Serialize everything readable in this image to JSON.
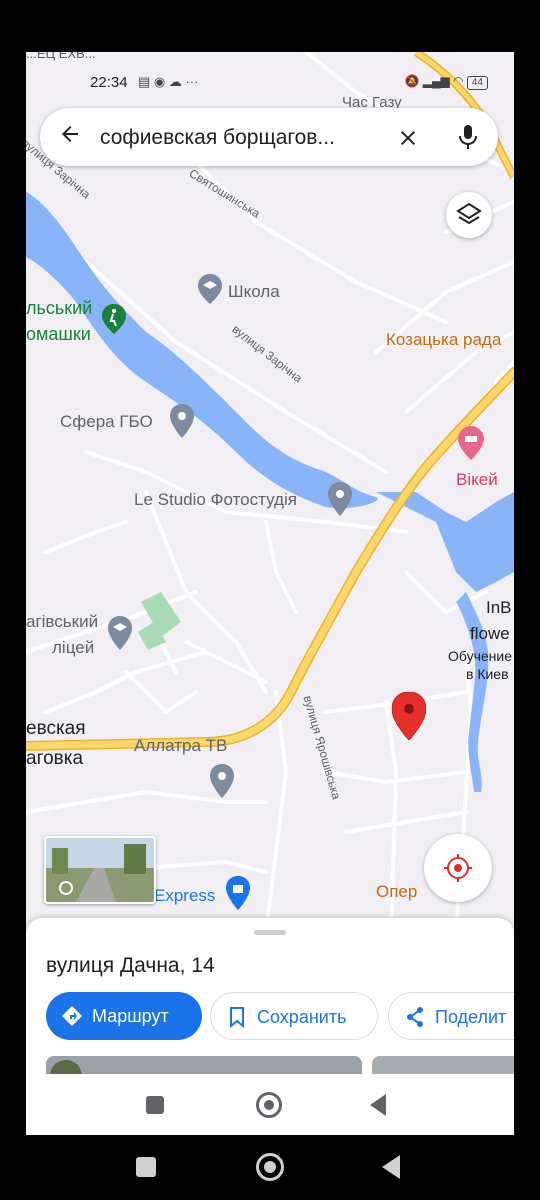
{
  "status_bar": {
    "top_cut_text": "...ЕЦ ЕХВ...",
    "time": "22:34",
    "notification_icons": "▤ ◉ ☁ ···",
    "carrier_text": "Час Газу",
    "battery": "44"
  },
  "search": {
    "query": "софиевская борщагов...",
    "back_icon": "arrow-left-icon",
    "clear_icon": "close-icon",
    "mic_icon": "mic-icon"
  },
  "map": {
    "streets": {
      "zarichna_1": "вулиця Зарічна",
      "zarichna_2": "вулиця Зарічна",
      "sviatoshynska": "Святошинська",
      "yaroshivska": "вулиця Ярошівська"
    },
    "pois": {
      "school": "Школа",
      "kozatska": "Козацька рада",
      "park_line1": "льський",
      "park_line2": "омашки",
      "sfera": "Сфера ГБО",
      "vikei": "Вікей",
      "lestudio": "Le Studio Фотостудія",
      "liceum_line1": "агівський",
      "liceum_line2": "ліцей",
      "inb_line1": "InB",
      "inb_line2": "flowe",
      "obuch_line1": "Обучение",
      "obuch_line2": "в Киев",
      "town_line1": "евская",
      "town_line2": "аговка",
      "allatra": "Аллатра ТВ",
      "express": "Express",
      "oper": "Опер"
    },
    "colors": {
      "land": "#f1eff3",
      "water": "#8ab4f8",
      "highway": "#fbd668",
      "highway_edge": "#e8b430",
      "road": "#ffffff",
      "marker": "#e8302b"
    }
  },
  "sheet": {
    "place_title": "вулиця Дачна, 14",
    "route_label": "Маршрут",
    "save_label": "Сохранить",
    "share_label": "Поделит"
  }
}
